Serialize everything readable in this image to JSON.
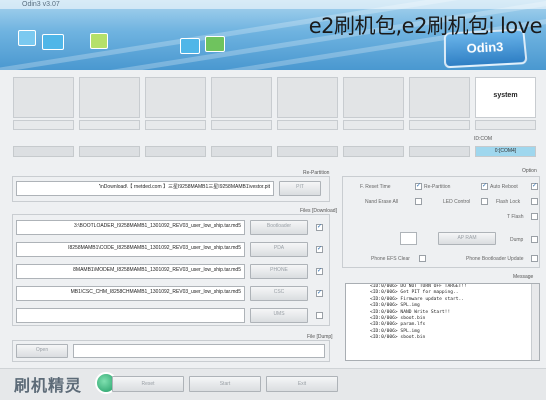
{
  "window": {
    "title": "Odin3 v3.07"
  },
  "watermark_top": "e2刷机包,e2刷机包i love",
  "logo_text": "Odin3",
  "slots": [
    {
      "label": "system",
      "active": true
    },
    {
      "label": "",
      "active": false
    },
    {
      "label": "",
      "active": false
    },
    {
      "label": "",
      "active": false
    },
    {
      "label": "",
      "active": false
    },
    {
      "label": "",
      "active": false
    },
    {
      "label": "",
      "active": false
    },
    {
      "label": "",
      "active": false
    }
  ],
  "idcom": {
    "label": "ID:COM",
    "ports": [
      "0:[COM4]",
      "",
      "",
      "",
      "",
      "",
      "",
      ""
    ]
  },
  "repartition": {
    "label": "Re-Partition",
    "pit_button": "PIT",
    "pit_path": "'\\nDownload\\【 rnetded.com 】三星I9258MAMB1三星I9258MAMB1\\vestor.pit"
  },
  "files": {
    "label": "Files [Download]",
    "rows": [
      {
        "button": "Bootloader",
        "path": "3:\\BOOTLOADER_I9258MAMB1_1301092_REV03_user_low_ship.tar.md5",
        "checked": true
      },
      {
        "button": "PDA",
        "path": "I8258MAMB1\\CODE_I8258MAMB1_1301092_REV03_user_low_ship.tar.md5",
        "checked": true
      },
      {
        "button": "PHONE",
        "path": "8MAMB1\\MODEM_I8258MAMB1_1301092_REV03_user_low_ship.tar.md5",
        "checked": true
      },
      {
        "button": "CSC",
        "path": "MB1\\CSC_CHM_I8258CHMAMB1_1301092_REV03_user_low_ship.tar.md5",
        "checked": true
      },
      {
        "button": "UMS",
        "path": "",
        "checked": false
      }
    ]
  },
  "option": {
    "label": "Option",
    "items": [
      {
        "label": "Auto Reboot",
        "kind": "check",
        "checked": true
      },
      {
        "label": "Re-Partition",
        "kind": "check",
        "checked": true
      },
      {
        "label": "F. Reset Time",
        "kind": "check",
        "checked": true
      },
      {
        "label": "Flash Lock",
        "kind": "check",
        "checked": false
      },
      {
        "label": "LED Control",
        "kind": "check",
        "checked": false
      },
      {
        "label": "Nand Erase All",
        "kind": "check",
        "checked": false
      },
      {
        "label": "T Flash",
        "kind": "check",
        "checked": false
      },
      {
        "label": "Dump",
        "kind": "check",
        "checked": false
      },
      {
        "label": "Phone Bootloader Update",
        "kind": "check",
        "checked": false
      },
      {
        "label": "Phone EFS Clear",
        "kind": "check",
        "checked": false
      }
    ],
    "dump_select": "AP RAM",
    "dump_value": ""
  },
  "message": {
    "label": "Message",
    "lines": [
      "<ID:0/006> DO NOT TURN OFF TARGET!!",
      "<ID:0/006> Get PIT for mapping..",
      "<ID:0/006> Firmware update start..",
      "<ID:0/006> SPL.img",
      "<ID:0/006> NAND Write Start!!",
      "<ID:0/006> sboot.bin",
      "<ID:0/006> param.lfs",
      "<ID:0/006> SPL.img",
      "<ID:0/006> sboot.bin"
    ]
  },
  "file_dump": {
    "label": "File [Dump]",
    "open_button": "Open"
  },
  "bottom": {
    "start_button": "Start",
    "reset_button": "Reset",
    "exit_button": "Exit",
    "brand_watermark": "刷机精灵"
  },
  "colors": {
    "accent": "#4a98d0",
    "active_port": "#9fd7ee"
  }
}
